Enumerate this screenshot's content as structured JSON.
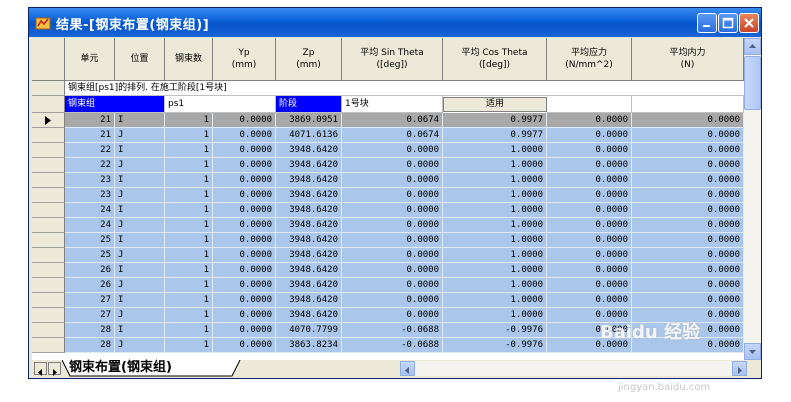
{
  "window": {
    "title": "结果-[钢束布置(钢束组)]",
    "minimize_label": "minimize",
    "maximize_label": "maximize",
    "close_label": "close"
  },
  "columns": [
    {
      "label": "单元"
    },
    {
      "label": "位置"
    },
    {
      "label": "钢束数"
    },
    {
      "label": "Yp\n(mm)"
    },
    {
      "label": "Zp\n(mm)"
    },
    {
      "label": "平均 Sin Theta\n([deg])"
    },
    {
      "label": "平均 Cos Theta\n([deg])"
    },
    {
      "label": "平均应力\n(N/mm^2)"
    },
    {
      "label": "平均内力\n(N)"
    }
  ],
  "info_row": "钢束组[ps1]的排列. 在施工阶段[1号块]",
  "selector": {
    "group_label": "钢束组",
    "group_value": "ps1",
    "stage_label": "阶段",
    "stage_value": "1号块",
    "apply_label": "适用"
  },
  "rows": [
    [
      "21",
      "I",
      "1",
      "0.0000",
      "3869.0951",
      "0.0674",
      "0.9977",
      "0.0000",
      "0.0000"
    ],
    [
      "21",
      "J",
      "1",
      "0.0000",
      "4071.6136",
      "0.0674",
      "0.9977",
      "0.0000",
      "0.0000"
    ],
    [
      "22",
      "I",
      "1",
      "0.0000",
      "3948.6420",
      "0.0000",
      "1.0000",
      "0.0000",
      "0.0000"
    ],
    [
      "22",
      "J",
      "1",
      "0.0000",
      "3948.6420",
      "0.0000",
      "1.0000",
      "0.0000",
      "0.0000"
    ],
    [
      "23",
      "I",
      "1",
      "0.0000",
      "3948.6420",
      "0.0000",
      "1.0000",
      "0.0000",
      "0.0000"
    ],
    [
      "23",
      "J",
      "1",
      "0.0000",
      "3948.6420",
      "0.0000",
      "1.0000",
      "0.0000",
      "0.0000"
    ],
    [
      "24",
      "I",
      "1",
      "0.0000",
      "3948.6420",
      "0.0000",
      "1.0000",
      "0.0000",
      "0.0000"
    ],
    [
      "24",
      "J",
      "1",
      "0.0000",
      "3948.6420",
      "0.0000",
      "1.0000",
      "0.0000",
      "0.0000"
    ],
    [
      "25",
      "I",
      "1",
      "0.0000",
      "3948.6420",
      "0.0000",
      "1.0000",
      "0.0000",
      "0.0000"
    ],
    [
      "25",
      "J",
      "1",
      "0.0000",
      "3948.6420",
      "0.0000",
      "1.0000",
      "0.0000",
      "0.0000"
    ],
    [
      "26",
      "I",
      "1",
      "0.0000",
      "3948.6420",
      "0.0000",
      "1.0000",
      "0.0000",
      "0.0000"
    ],
    [
      "26",
      "J",
      "1",
      "0.0000",
      "3948.6420",
      "0.0000",
      "1.0000",
      "0.0000",
      "0.0000"
    ],
    [
      "27",
      "I",
      "1",
      "0.0000",
      "3948.6420",
      "0.0000",
      "1.0000",
      "0.0000",
      "0.0000"
    ],
    [
      "27",
      "J",
      "1",
      "0.0000",
      "3948.6420",
      "0.0000",
      "1.0000",
      "0.0000",
      "0.0000"
    ],
    [
      "28",
      "I",
      "1",
      "0.0000",
      "4070.7799",
      "-0.0688",
      "-0.9976",
      "0.0000",
      "0.0000"
    ],
    [
      "28",
      "J",
      "1",
      "0.0000",
      "3863.8234",
      "-0.0688",
      "-0.9976",
      "0.0000",
      "0.0000"
    ]
  ],
  "sheet_tab": "钢束布置(钢束组)",
  "watermark": "Baidu 经验",
  "watermark_sub": "jingyan.baidu.com",
  "colors": {
    "row_blue": "#aac6ea",
    "row_first": "#a8a8a8",
    "selector_blue": "#0000ff",
    "title_blue": "#0a5fd8"
  },
  "icons": [
    "app-icon",
    "minimize-icon",
    "maximize-icon",
    "close-icon",
    "row-pointer-icon",
    "scroll-up-icon",
    "scroll-down-icon",
    "first-sheet-icon",
    "last-sheet-icon",
    "scroll-left-icon",
    "scroll-right-icon"
  ]
}
